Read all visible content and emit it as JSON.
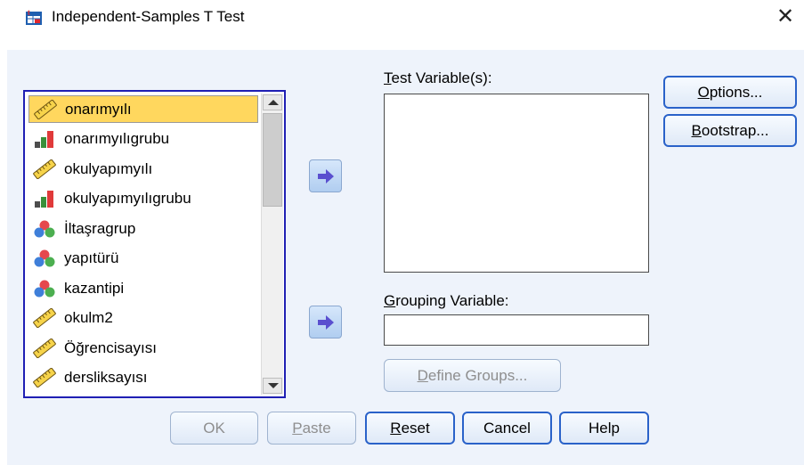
{
  "window": {
    "title": "Independent-Samples T Test",
    "close_glyph": "✕"
  },
  "variables": [
    {
      "name": "onarımyılı",
      "icon": "scale-ruler-icon",
      "selected": true
    },
    {
      "name": "onarımyılıgrubu",
      "icon": "ordinal-bars-icon",
      "selected": false
    },
    {
      "name": "okulyapımyılı",
      "icon": "scale-ruler-icon",
      "selected": false
    },
    {
      "name": "okulyapımyılıgrubu",
      "icon": "ordinal-bars-icon",
      "selected": false
    },
    {
      "name": "İltaşragrup",
      "icon": "nominal-balls-icon",
      "selected": false
    },
    {
      "name": "yapıtürü",
      "icon": "nominal-balls-icon",
      "selected": false
    },
    {
      "name": "kazantipi",
      "icon": "nominal-balls-icon",
      "selected": false
    },
    {
      "name": "okulm2",
      "icon": "scale-ruler-icon",
      "selected": false
    },
    {
      "name": "Öğrencisayısı",
      "icon": "scale-ruler-icon",
      "selected": false
    },
    {
      "name": "dersliksayısı",
      "icon": "scale-ruler-icon",
      "selected": false
    }
  ],
  "test_variables": {
    "label_first": "T",
    "label_rest": "est Variable(s):"
  },
  "grouping": {
    "label_first": "G",
    "label_rest": "rouping Variable:",
    "value": ""
  },
  "define_groups": {
    "first": "D",
    "rest": "efine Groups..."
  },
  "side_buttons": {
    "options": {
      "first": "O",
      "rest": "ptions..."
    },
    "bootstrap": {
      "first": "B",
      "rest": "ootstrap..."
    }
  },
  "bottom_buttons": {
    "ok": "OK",
    "paste": {
      "first": "P",
      "rest": "aste"
    },
    "reset": {
      "first": "R",
      "rest": "eset"
    },
    "cancel": "Cancel",
    "help": "Help"
  },
  "colors": {
    "accent": "#2a62c9",
    "selection": "#ffd75e",
    "panel": "#eef3fb",
    "arrow": "#5a4fcf"
  }
}
